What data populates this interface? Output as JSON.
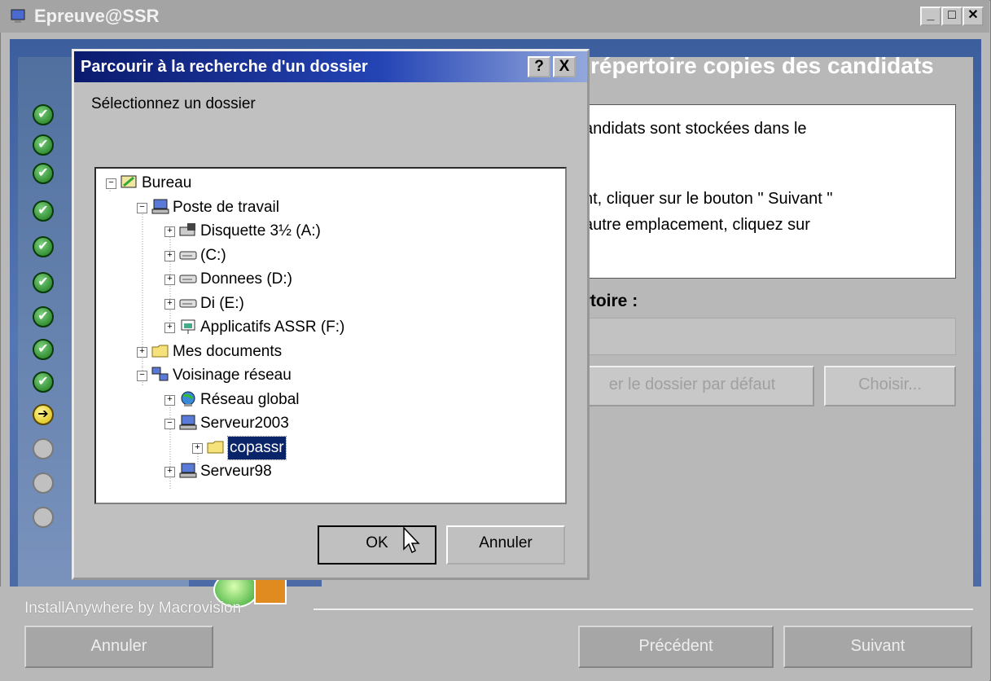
{
  "window": {
    "title": "Epreuve@SSR",
    "controls": [
      "minimize",
      "maximize",
      "close"
    ]
  },
  "heading": "répertoire copies des candidats",
  "info": {
    "line1": "andidats sont stockées dans le",
    "line2": "nt, cliquer sur le bouton \" Suivant \"",
    "line3": " autre emplacement, cliquez sur"
  },
  "directory_label": "ertoire :",
  "directory_value": "",
  "buttons": {
    "default_dir": "er le dossier par défaut",
    "choose": "Choisir..."
  },
  "steps": [
    {
      "state": "done"
    },
    {
      "state": "done"
    },
    {
      "state": "done"
    },
    {
      "state": "done"
    },
    {
      "state": "done"
    },
    {
      "state": "done"
    },
    {
      "state": "done"
    },
    {
      "state": "done"
    },
    {
      "state": "done"
    },
    {
      "state": "current"
    },
    {
      "state": "todo"
    },
    {
      "state": "todo"
    },
    {
      "state": "todo"
    }
  ],
  "footer": {
    "brand": "InstallAnywhere by Macrovision",
    "cancel": "Annuler",
    "previous": "Précédent",
    "next": "Suivant"
  },
  "dialog": {
    "title": "Parcourir à la recherche d'un dossier",
    "help": "?",
    "close": "X",
    "prompt": "Sélectionnez un dossier",
    "ok": "OK",
    "cancel": "Annuler",
    "tree": [
      {
        "label": "Bureau",
        "icon": "desktop-icon",
        "expander": "-"
      },
      {
        "label": "Poste de travail",
        "icon": "computer-icon",
        "expander": "-"
      },
      {
        "label": "Disquette 3½ (A:)",
        "icon": "floppy-icon",
        "expander": "+"
      },
      {
        "label": " (C:)",
        "icon": "drive-icon",
        "expander": "+"
      },
      {
        "label": "Donnees (D:)",
        "icon": "drive-icon",
        "expander": "+"
      },
      {
        "label": "Di (E:)",
        "icon": "drive-icon",
        "expander": "+"
      },
      {
        "label": "Applicatifs ASSR (F:)",
        "icon": "network-drive-icon",
        "expander": "+"
      },
      {
        "label": "Mes documents",
        "icon": "folder-icon",
        "expander": "+"
      },
      {
        "label": "Voisinage réseau",
        "icon": "network-icon",
        "expander": "-"
      },
      {
        "label": "Réseau global",
        "icon": "globe-icon",
        "expander": "+"
      },
      {
        "label": "Serveur2003",
        "icon": "computer-icon",
        "expander": "-"
      },
      {
        "label": "copassr",
        "icon": "folder-icon",
        "expander": "+",
        "selected": true
      },
      {
        "label": "Serveur98",
        "icon": "computer-icon",
        "expander": "+"
      }
    ]
  }
}
